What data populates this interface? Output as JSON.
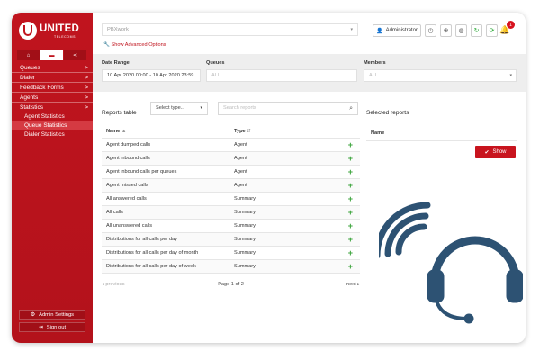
{
  "logo": {
    "brand": "UNITED",
    "tagline": "TELECOMS"
  },
  "sidebar": {
    "tabs": [
      {
        "icon": "home-icon",
        "glyph": "⌂"
      },
      {
        "icon": "briefcase-icon",
        "glyph": "▬"
      },
      {
        "icon": "share-icon",
        "glyph": "⋖"
      }
    ],
    "items": [
      {
        "label": "Queues",
        "arrow": ">"
      },
      {
        "label": "Dialer",
        "arrow": ">"
      },
      {
        "label": "Feedback Forms",
        "arrow": ">"
      },
      {
        "label": "Agents",
        "arrow": ">"
      },
      {
        "label": "Statistics",
        "arrow": ">"
      }
    ],
    "subitems": [
      {
        "label": "Agent Statistics"
      },
      {
        "label": "Queue Statistics"
      },
      {
        "label": "Dialer Statistics"
      }
    ],
    "admin_settings": "Admin Settings",
    "sign_out": "Sign out"
  },
  "topbar": {
    "pbx_placeholder": "PBXwork",
    "advanced_options": "Show Advanced Options",
    "admin_label": "Administrator",
    "notification_count": "1"
  },
  "filters": {
    "date_label": "Date Range",
    "date_value": "10 Apr 2020 00:00 - 10 Apr 2020 23:59",
    "queues_label": "Queues",
    "queues_value": "ALL",
    "members_label": "Members",
    "members_value": "ALL"
  },
  "reports": {
    "title": "Reports table",
    "type_placeholder": "Select type..",
    "search_placeholder": "Search reports",
    "col_name": "Name",
    "col_type": "Type",
    "rows": [
      {
        "name": "Agent dumped calls",
        "type": "Agent"
      },
      {
        "name": "Agent inbound calls",
        "type": "Agent"
      },
      {
        "name": "Agent inbound calls per queues",
        "type": "Agent"
      },
      {
        "name": "Agent missed calls",
        "type": "Agent"
      },
      {
        "name": "All answered calls",
        "type": "Summary"
      },
      {
        "name": "All calls",
        "type": "Summary"
      },
      {
        "name": "All unanswered calls",
        "type": "Summary"
      },
      {
        "name": "Distributions for all calls per day",
        "type": "Summary"
      },
      {
        "name": "Distributions for all calls per day of month",
        "type": "Summary"
      },
      {
        "name": "Distributions for all calls per day of week",
        "type": "Summary"
      }
    ],
    "prev": "previous",
    "page": "Page 1 of 2",
    "next": "next"
  },
  "selected": {
    "title": "Selected reports",
    "col_name": "Name",
    "show": "Show"
  },
  "colors": {
    "brand_red": "#c0141e",
    "green": "#3da53d",
    "headset_blue": "#2d5273"
  }
}
